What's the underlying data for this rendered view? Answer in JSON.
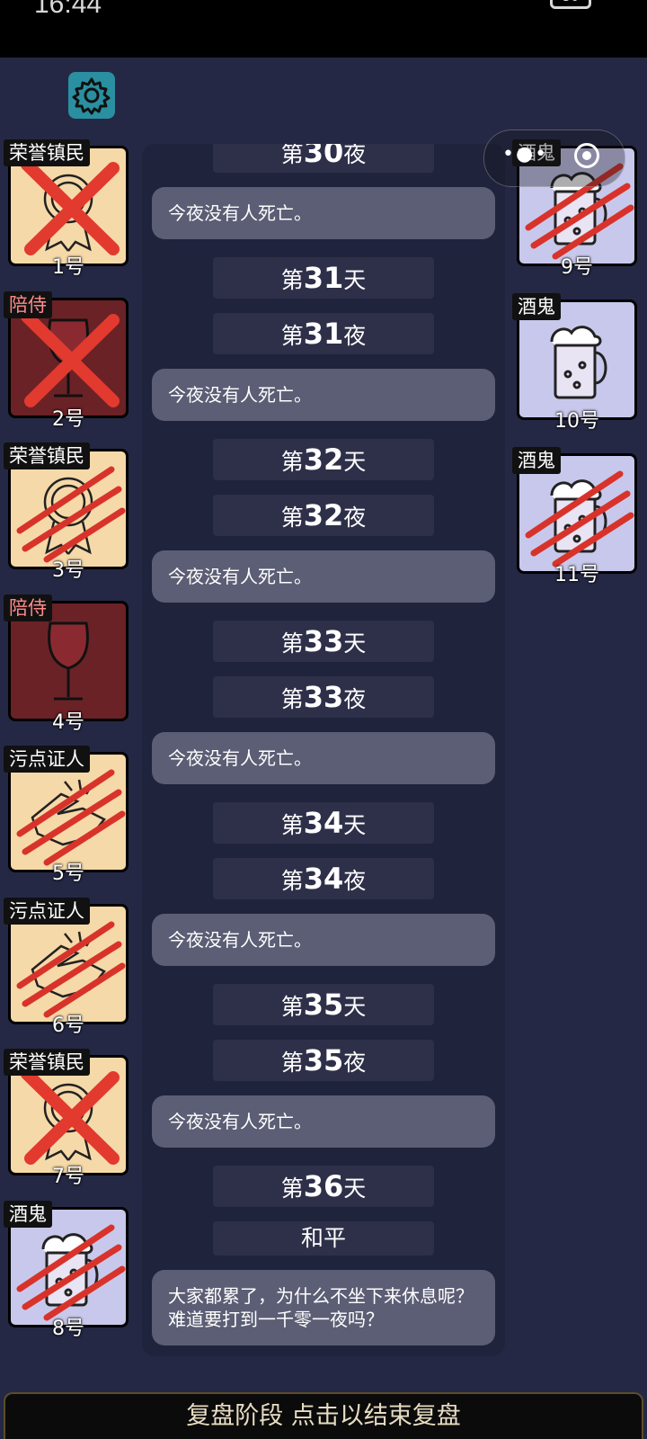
{
  "status_bar": {
    "time": "16:44",
    "battery": "56"
  },
  "settings": {
    "icon": "gear-icon"
  },
  "capsule": {
    "more_icon": "more-dots-icon",
    "close_icon": "target-close-icon"
  },
  "seats_left": [
    {
      "role": "荣誉镇民",
      "num": "1号",
      "bg": "#f6d9a8",
      "art": "medal",
      "mark": "x",
      "evil": false
    },
    {
      "role": "陪侍",
      "num": "2号",
      "bg": "#6a2226",
      "art": "wine",
      "mark": "x",
      "evil": true
    },
    {
      "role": "荣誉镇民",
      "num": "3号",
      "bg": "#f6d9a8",
      "art": "medal",
      "mark": "claw",
      "evil": false
    },
    {
      "role": "陪侍",
      "num": "4号",
      "bg": "#6a2226",
      "art": "wine",
      "mark": "none",
      "evil": true
    },
    {
      "role": "污点证人",
      "num": "5号",
      "bg": "#f6d9a8",
      "art": "hands",
      "mark": "claw",
      "evil": false
    },
    {
      "role": "污点证人",
      "num": "6号",
      "bg": "#f6d9a8",
      "art": "hands",
      "mark": "claw",
      "evil": false
    },
    {
      "role": "荣誉镇民",
      "num": "7号",
      "bg": "#f6d9a8",
      "art": "medal",
      "mark": "x",
      "evil": false
    },
    {
      "role": "酒鬼",
      "num": "8号",
      "bg": "#c8c8ec",
      "art": "beer",
      "mark": "claw",
      "evil": false
    }
  ],
  "seats_right": [
    {
      "role": "酒鬼",
      "num": "9号",
      "bg": "#c8c8ec",
      "art": "beer",
      "mark": "claw",
      "evil": false
    },
    {
      "role": "酒鬼",
      "num": "10号",
      "bg": "#c8c8ec",
      "art": "beer",
      "mark": "none",
      "evil": false
    },
    {
      "role": "酒鬼",
      "num": "11号",
      "bg": "#c8c8ec",
      "art": "beer",
      "mark": "claw",
      "evil": false
    }
  ],
  "log": [
    {
      "type": "label",
      "pre": "第",
      "num": "30",
      "post": "夜"
    },
    {
      "type": "bubble",
      "text": "今夜没有人死亡。"
    },
    {
      "type": "label",
      "pre": "第",
      "num": "31",
      "post": "天"
    },
    {
      "type": "label",
      "pre": "第",
      "num": "31",
      "post": "夜"
    },
    {
      "type": "bubble",
      "text": "今夜没有人死亡。"
    },
    {
      "type": "label",
      "pre": "第",
      "num": "32",
      "post": "天"
    },
    {
      "type": "label",
      "pre": "第",
      "num": "32",
      "post": "夜"
    },
    {
      "type": "bubble",
      "text": "今夜没有人死亡。"
    },
    {
      "type": "label",
      "pre": "第",
      "num": "33",
      "post": "天"
    },
    {
      "type": "label",
      "pre": "第",
      "num": "33",
      "post": "夜"
    },
    {
      "type": "bubble",
      "text": "今夜没有人死亡。"
    },
    {
      "type": "label",
      "pre": "第",
      "num": "34",
      "post": "天"
    },
    {
      "type": "label",
      "pre": "第",
      "num": "34",
      "post": "夜"
    },
    {
      "type": "bubble",
      "text": "今夜没有人死亡。"
    },
    {
      "type": "label",
      "pre": "第",
      "num": "35",
      "post": "天"
    },
    {
      "type": "label",
      "pre": "第",
      "num": "35",
      "post": "夜"
    },
    {
      "type": "bubble",
      "text": "今夜没有人死亡。"
    },
    {
      "type": "label",
      "pre": "第",
      "num": "36",
      "post": "天"
    },
    {
      "type": "label",
      "pre": "和平",
      "num": "",
      "post": ""
    },
    {
      "type": "bubble",
      "text": "大家都累了，为什么不坐下来休息呢？难道要打到一千零一夜吗？"
    }
  ],
  "bottom_button": {
    "label": "复盘阶段 点击以结束复盘"
  }
}
